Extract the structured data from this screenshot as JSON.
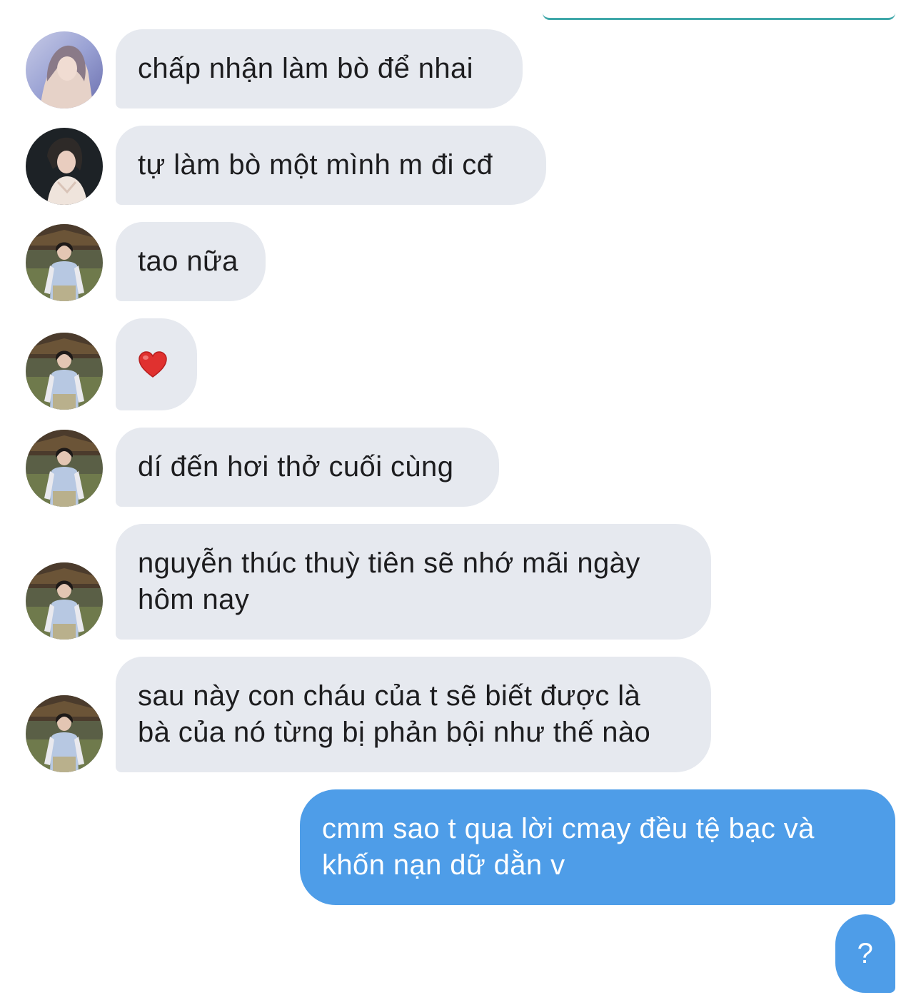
{
  "colors": {
    "incoming_bubble": "#e6e9ef",
    "outgoing_bubble": "#4e9de8",
    "accent_line": "#3fa7a9"
  },
  "messages": [
    {
      "direction": "incoming",
      "sender_avatar": "avatar-a",
      "text": "chấp nhận làm bò để nhai"
    },
    {
      "direction": "incoming",
      "sender_avatar": "avatar-b",
      "text": "tự làm bò một mình m đi cđ"
    },
    {
      "direction": "incoming",
      "sender_avatar": "avatar-c",
      "text": "tao nữa"
    },
    {
      "direction": "incoming",
      "sender_avatar": "avatar-c",
      "text": "",
      "emoji": "heart-icon"
    },
    {
      "direction": "incoming",
      "sender_avatar": "avatar-c",
      "text": "dí đến hơi thở cuối cùng"
    },
    {
      "direction": "incoming",
      "sender_avatar": "avatar-c",
      "lines": [
        "nguyễn thúc thuỳ tiên sẽ nhớ mãi ngày",
        "hôm nay"
      ]
    },
    {
      "direction": "incoming",
      "sender_avatar": "avatar-c",
      "lines": [
        "sau này con cháu của t sẽ biết được là",
        "bà của nó từng bị phản bội như thế nào"
      ]
    },
    {
      "direction": "outgoing",
      "lines": [
        "cmm sao t qua lời cmay đều tệ bạc và",
        "khốn nạn dữ dằn v"
      ]
    },
    {
      "direction": "outgoing",
      "text": "?"
    }
  ]
}
